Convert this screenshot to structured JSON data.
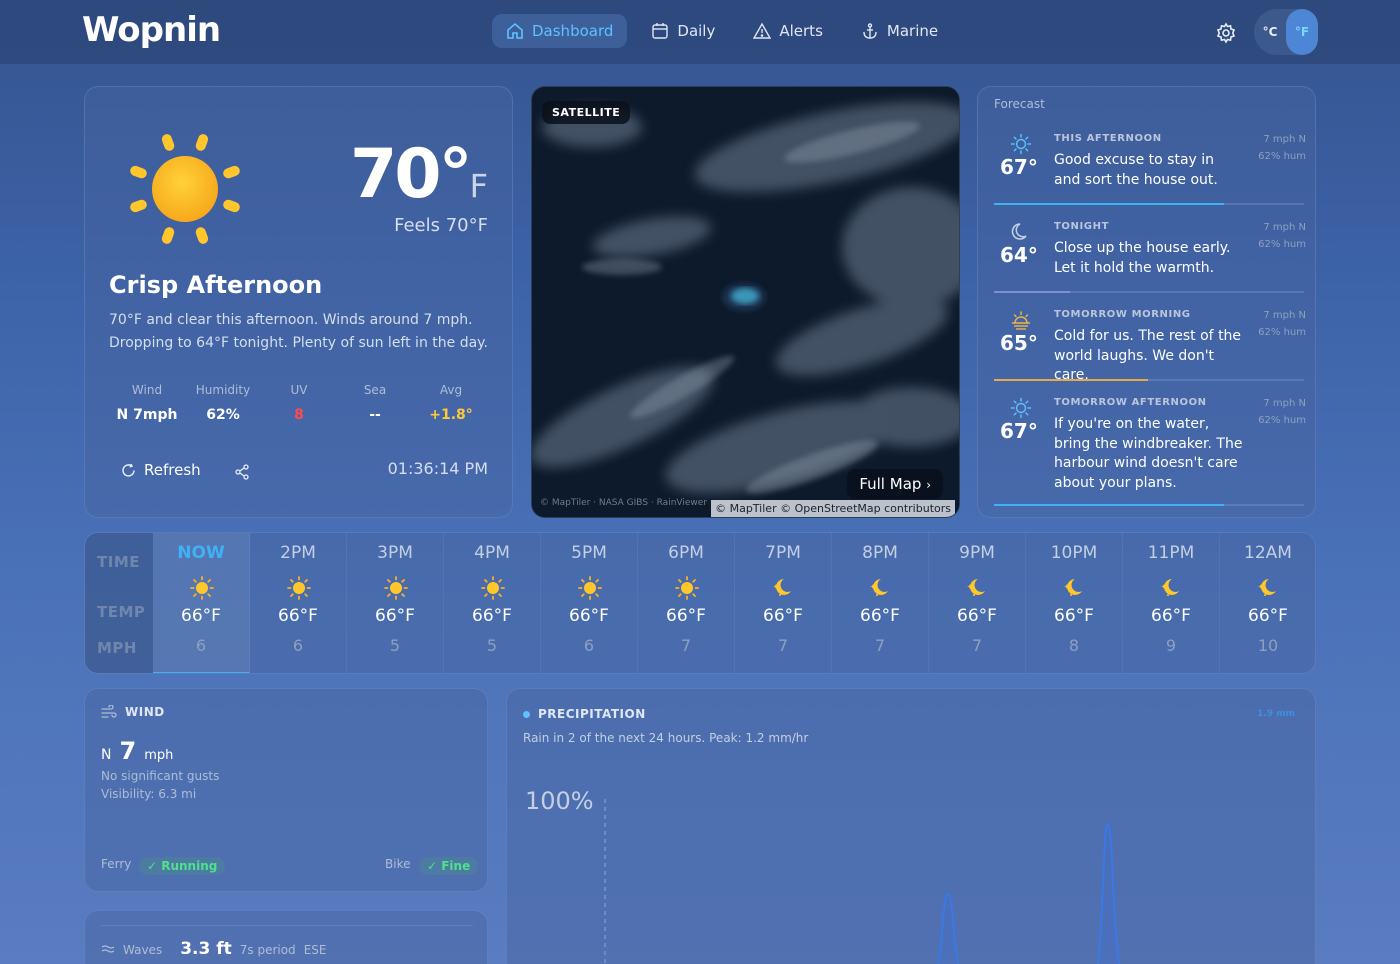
{
  "app": {
    "logo": "Wopnin"
  },
  "nav": [
    {
      "label": "Dashboard",
      "active": true
    },
    {
      "label": "Daily"
    },
    {
      "label": "Alerts"
    },
    {
      "label": "Marine"
    }
  ],
  "units": {
    "celsius": "°C",
    "fahrenheit": "°F",
    "selected": "°F"
  },
  "current": {
    "temp": "70°",
    "unit": "F",
    "feels": "Feels 70°F",
    "title": "Crisp Afternoon",
    "description": "70°F and clear this afternoon. Winds around 7 mph. Dropping to 64°F tonight. Plenty of sun left in the day.",
    "stats": [
      {
        "label": "Wind",
        "value": "N 7mph",
        "color": "#ffffff"
      },
      {
        "label": "Humidity",
        "value": "62%",
        "color": "#ffffff"
      },
      {
        "label": "UV",
        "value": "8",
        "color": "#ff4a4a"
      },
      {
        "label": "Sea",
        "value": "--",
        "color": "#ffffff"
      },
      {
        "label": "Avg",
        "value": "+1.8°",
        "color": "#ffc83a"
      }
    ],
    "refresh_label": "Refresh",
    "time": "01:36:14 PM"
  },
  "map": {
    "badge": "SATELLITE",
    "full_map": "Full Map",
    "attribution_left": "© MapTiler · NASA GIBS · RainViewer",
    "attribution_right": "© MapTiler © OpenStreetMap contributors"
  },
  "forecast": {
    "title": "Forecast",
    "items": [
      {
        "label": "THIS AFTERNOON",
        "temp": "67°",
        "text": "Good excuse to stay in and sort the house out.",
        "wind": "7 mph N",
        "hum": "62% hum",
        "icon": "sun-icon",
        "accent": "#3fb2f5"
      },
      {
        "label": "TONIGHT",
        "temp": "64°",
        "text": "Close up the house early. Let it hold the warmth.",
        "wind": "7 mph N",
        "hum": "62% hum",
        "icon": "moon-icon",
        "accent": "#7e8fd8"
      },
      {
        "label": "TOMORROW MORNING",
        "temp": "65°",
        "text": "Cold for us. The rest of the world laughs. We don't care.",
        "wind": "7 mph N",
        "hum": "62% hum",
        "icon": "sunrise-icon",
        "accent": "#e8a94a"
      },
      {
        "label": "TOMORROW AFTERNOON",
        "temp": "67°",
        "text": "If you're on the water, bring the windbreaker. The harbour wind doesn't care about your plans.",
        "wind": "7 mph N",
        "hum": "62% hum",
        "icon": "sun-icon",
        "accent": "#3fb2f5"
      }
    ]
  },
  "hourly": {
    "row_labels": {
      "time": "TIME",
      "temp": "TEMP",
      "wind": "MPH"
    },
    "hours": [
      {
        "time": "NOW",
        "temp": "66°F",
        "wind": "6",
        "icon": "sun-icon",
        "now": true
      },
      {
        "time": "2PM",
        "temp": "66°F",
        "wind": "6",
        "icon": "sun-icon"
      },
      {
        "time": "3PM",
        "temp": "66°F",
        "wind": "5",
        "icon": "sun-icon"
      },
      {
        "time": "4PM",
        "temp": "66°F",
        "wind": "5",
        "icon": "sun-icon"
      },
      {
        "time": "5PM",
        "temp": "66°F",
        "wind": "6",
        "icon": "sun-icon"
      },
      {
        "time": "6PM",
        "temp": "66°F",
        "wind": "7",
        "icon": "sun-icon"
      },
      {
        "time": "7PM",
        "temp": "66°F",
        "wind": "7",
        "icon": "moon-star-icon"
      },
      {
        "time": "8PM",
        "temp": "66°F",
        "wind": "7",
        "icon": "moon-star-icon"
      },
      {
        "time": "9PM",
        "temp": "66°F",
        "wind": "7",
        "icon": "moon-star-icon"
      },
      {
        "time": "10PM",
        "temp": "66°F",
        "wind": "8",
        "icon": "moon-star-icon"
      },
      {
        "time": "11PM",
        "temp": "66°F",
        "wind": "9",
        "icon": "moon-star-icon"
      },
      {
        "time": "12AM",
        "temp": "66°F",
        "wind": "10",
        "icon": "moon-star-icon"
      }
    ]
  },
  "wind": {
    "title": "WIND",
    "direction": "N",
    "speed": "7",
    "unit": "mph",
    "gusts": "No significant gusts",
    "visibility": "Visibility: 6.3 mi",
    "ferry_label": "Ferry",
    "ferry_status": "✓ Running",
    "bike_label": "Bike",
    "bike_status": "✓ Fine"
  },
  "waves": {
    "label": "Waves",
    "height": "3.3 ft",
    "period": "7s period",
    "direction": "ESE"
  },
  "precipitation": {
    "title": "PRECIPITATION",
    "summary": "Rain in 2 of the next 24 hours. Peak: 1.2 mm/hr",
    "peak_badge": "1.9 mm",
    "axis_label": "100%"
  }
}
